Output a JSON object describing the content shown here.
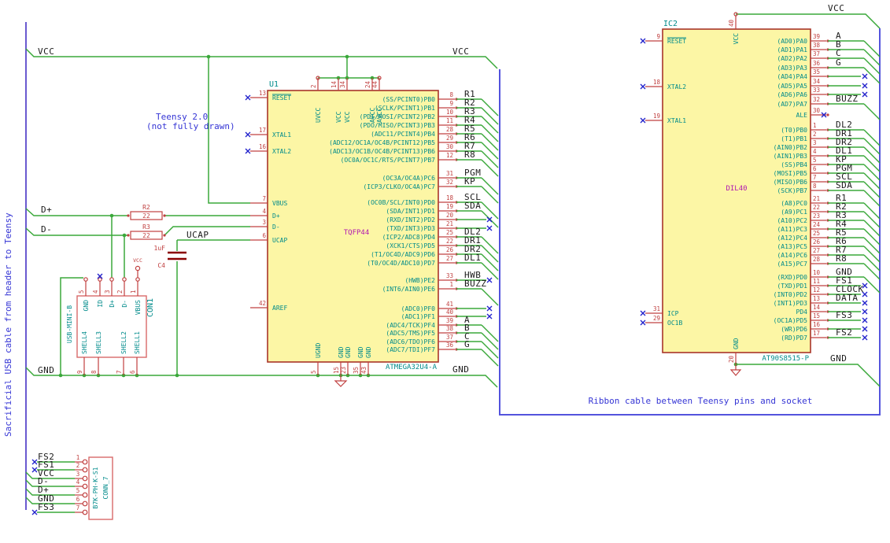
{
  "notes": {
    "left_cable": "Sacrificial USB cable from header to Teensy",
    "teensy_title": "Teensy 2.0",
    "teensy_sub": "(not fully drawn)",
    "ribbon": "Ribbon cable between Teensy pins and socket"
  },
  "power": {
    "vcc": "VCC",
    "gnd": "GND",
    "ucap": "UCAP",
    "dp": "D+",
    "dm": "D-",
    "vcc_small": "VCC"
  },
  "colors": {
    "wire": "#3aa83a",
    "pin": "#c04040",
    "body_border": "#a8352a",
    "body_fill": "#fcf6a5",
    "connector_border": "#d96a6a",
    "nc": "#2323cc",
    "frame": "#5353dd",
    "cable": "#6a5ad0",
    "junction": "#3aa83a",
    "plate": "#8a0000"
  },
  "u1": {
    "ref": "U1",
    "value": "TQFP44",
    "part": "ATMEGA32U4-A",
    "left_pins": [
      {
        "num": "13",
        "name": "RESET",
        "nc": true,
        "overline": true
      },
      {
        "num": "17",
        "name": "XTAL1",
        "nc": true
      },
      {
        "num": "16",
        "name": "XTAL2",
        "nc": true
      },
      {
        "num": "7",
        "name": "VBUS"
      },
      {
        "num": "4",
        "name": "D+"
      },
      {
        "num": "3",
        "name": "D-"
      },
      {
        "num": "6",
        "name": "UCAP"
      },
      {
        "num": "42",
        "name": "AREF"
      }
    ],
    "top_pins": [
      {
        "num": "2",
        "name": "UVCC"
      },
      {
        "num": "14",
        "name": "VCC"
      },
      {
        "num": "34",
        "name": "VCC"
      },
      {
        "num": "24",
        "name": "AVCC"
      },
      {
        "num": "44",
        "name": "AVCC"
      }
    ],
    "bottom_pins": [
      {
        "num": "5",
        "name": "UGND"
      },
      {
        "num": "15",
        "name": "GND"
      },
      {
        "num": "23",
        "name": "GND"
      },
      {
        "num": "35",
        "name": "GND"
      },
      {
        "num": "43",
        "name": "GND"
      }
    ],
    "right_groups": [
      {
        "pins": [
          {
            "num": "8",
            "name": "(SS/PCINT0)PB0",
            "net": "R1"
          },
          {
            "num": "9",
            "name": "(SCLK/PCINT1)PB1",
            "net": "R2"
          },
          {
            "num": "10",
            "name": "(PDI/MOSI/PCINT2)PB2",
            "net": "R3"
          },
          {
            "num": "11",
            "name": "(PDO/MISO/PCINT3)PB3",
            "net": "R4"
          },
          {
            "num": "28",
            "name": "(ADC11/PCINT4)PB4",
            "net": "R5"
          },
          {
            "num": "29",
            "name": "(ADC12/OC1A/OC4B/PCINT12)PB5",
            "net": "R6"
          },
          {
            "num": "30",
            "name": "(ADC13/OC1B/OC4B/PCINT13)PB6",
            "net": "R7"
          },
          {
            "num": "12",
            "name": "(OC0A/OC1C/RTS/PCINT7)PB7",
            "net": "R8"
          }
        ]
      },
      {
        "pins": [
          {
            "num": "31",
            "name": "(OC3A/OC4A)PC6",
            "net": "PGM"
          },
          {
            "num": "32",
            "name": "(ICP3/CLKO/OC4A)PC7",
            "net": "KP"
          }
        ]
      },
      {
        "pins": [
          {
            "num": "18",
            "name": "(OC0B/SCL/INT0)PD0",
            "net": "SCL"
          },
          {
            "num": "19",
            "name": "(SDA/INT1)PD1",
            "net": "SDA"
          },
          {
            "num": "20",
            "name": "(RXD/INT2)PD2",
            "nc": true
          },
          {
            "num": "21",
            "name": "(TXD/INT3)PD3",
            "nc": true
          },
          {
            "num": "25",
            "name": "(ICP2/ADC8)PD4",
            "net": "DL2"
          },
          {
            "num": "22",
            "name": "(XCK1/CTS)PD5",
            "net": "DR1"
          },
          {
            "num": "26",
            "name": "(T1/OC4D/ADC9)PD6",
            "net": "DR2"
          },
          {
            "num": "27",
            "name": "(T0/OC4D/ADC10)PD7",
            "net": "DL1"
          }
        ]
      },
      {
        "pins": [
          {
            "num": "33",
            "name": "(HWB)PE2",
            "net": "HWB",
            "nc": true
          },
          {
            "num": "1",
            "name": "(INT6/AIN0)PE6",
            "net": "BUZZ"
          }
        ]
      },
      {
        "pins": [
          {
            "num": "41",
            "name": "(ADC0)PF0",
            "nc": true
          },
          {
            "num": "40",
            "name": "(ADC1)PF1",
            "nc": true
          },
          {
            "num": "39",
            "name": "(ADC4/TCK)PF4",
            "net": "A"
          },
          {
            "num": "38",
            "name": "(ADC5/TMS)PF5",
            "net": "B"
          },
          {
            "num": "37",
            "name": "(ADC6/TDO)PF6",
            "net": "C"
          },
          {
            "num": "36",
            "name": "(ADC7/TDI)PF7",
            "net": "G"
          }
        ]
      }
    ]
  },
  "ic2": {
    "ref": "IC2",
    "value": "DIL40",
    "part": "AT90S8515-P",
    "left_pins": [
      {
        "num": "9",
        "name": "RESET",
        "nc": true,
        "overline": true
      },
      {
        "num": "18",
        "name": "XTAL2",
        "nc": true
      },
      {
        "num": "19",
        "name": "XTAL1",
        "nc": true
      },
      {
        "num": "31",
        "name": "ICP",
        "nc": true
      },
      {
        "num": "29",
        "name": "OC1B",
        "nc": true
      }
    ],
    "top_pins": [
      {
        "num": "40",
        "name": "VCC"
      }
    ],
    "bottom_pins": [
      {
        "num": "20",
        "name": "GND"
      }
    ],
    "right_groups": [
      {
        "pins": [
          {
            "num": "39",
            "name": "(AD0)PA0",
            "net": "A"
          },
          {
            "num": "38",
            "name": "(AD1)PA1",
            "net": "B"
          },
          {
            "num": "37",
            "name": "(AD2)PA2",
            "net": "C"
          },
          {
            "num": "36",
            "name": "(AD3)PA3",
            "net": "G"
          },
          {
            "num": "35",
            "name": "(AD4)PA4",
            "nc": true
          },
          {
            "num": "34",
            "name": "(AD5)PA5",
            "nc": true
          },
          {
            "num": "33",
            "name": "(AD6)PA6",
            "nc": true
          },
          {
            "num": "32",
            "name": "(AD7)PA7",
            "net": "BUZZ"
          }
        ]
      },
      {
        "pins": [
          {
            "num": "30",
            "name": "ALE",
            "nc": true,
            "short": true
          }
        ]
      },
      {
        "pins": [
          {
            "num": "1",
            "name": "(T0)PB0",
            "net": "DL2"
          },
          {
            "num": "2",
            "name": "(T1)PB1",
            "net": "DR1"
          },
          {
            "num": "3",
            "name": "(AIN0)PB2",
            "net": "DR2"
          },
          {
            "num": "4",
            "name": "(AIN1)PB3",
            "net": "DL1"
          },
          {
            "num": "5",
            "name": "(SS)PB4",
            "net": "KP"
          },
          {
            "num": "6",
            "name": "(MOSI)PB5",
            "net": "PGM"
          },
          {
            "num": "7",
            "name": "(MISO)PB6",
            "net": "SCL"
          },
          {
            "num": "8",
            "name": "(SCK)PB7",
            "net": "SDA"
          }
        ]
      },
      {
        "pins": [
          {
            "num": "21",
            "name": "(A8)PC0",
            "net": "R1"
          },
          {
            "num": "22",
            "name": "(A9)PC1",
            "net": "R2"
          },
          {
            "num": "23",
            "name": "(A10)PC2",
            "net": "R3"
          },
          {
            "num": "24",
            "name": "(A11)PC3",
            "net": "R4"
          },
          {
            "num": "25",
            "name": "(A12)PC4",
            "net": "R5"
          },
          {
            "num": "26",
            "name": "(A13)PC5",
            "net": "R6"
          },
          {
            "num": "27",
            "name": "(A14)PC6",
            "net": "R7"
          },
          {
            "num": "28",
            "name": "(A15)PC7",
            "net": "R8"
          }
        ]
      },
      {
        "pins": [
          {
            "num": "10",
            "name": "(RXD)PD0",
            "net": "GND"
          },
          {
            "num": "11",
            "name": "(TXD)PD1",
            "net": "FS1",
            "nc": true
          },
          {
            "num": "12",
            "name": "(INT0)PD2",
            "net": "CLOCK",
            "nc": true
          },
          {
            "num": "13",
            "name": "(INT1)PD3",
            "net": "DATA",
            "nc": true
          },
          {
            "num": "14",
            "name": "PD4",
            "nc": true
          },
          {
            "num": "15",
            "name": "(OC1A)PD5",
            "net": "FS3",
            "nc": true
          },
          {
            "num": "16",
            "name": "(WR)PD6",
            "nc": true
          },
          {
            "num": "17",
            "name": "(RD)PD7",
            "net": "FS2",
            "nc": true
          }
        ]
      }
    ]
  },
  "usb": {
    "ref": "CON1",
    "value": "USB-MINI-B",
    "top_pins": [
      {
        "num": "5",
        "name": "GND"
      },
      {
        "num": "4",
        "name": "ID",
        "nc": true
      },
      {
        "num": "3",
        "name": "D+"
      },
      {
        "num": "2",
        "name": "D-"
      },
      {
        "num": "1",
        "name": "VBUS"
      }
    ],
    "shell_pins": [
      {
        "num": "9",
        "name": "SHELL4"
      },
      {
        "num": "8",
        "name": "SHELL3"
      },
      {
        "num": "7",
        "name": "SHELL2"
      },
      {
        "num": "6",
        "name": "SHELL1"
      }
    ]
  },
  "conn7": {
    "ref": "CONN_7",
    "value": "B7K-PH-K-S1",
    "rows": [
      {
        "num": "1",
        "net": "FS2",
        "nc": true
      },
      {
        "num": "2",
        "net": "FS1",
        "nc": true
      },
      {
        "num": "3",
        "net": "VCC"
      },
      {
        "num": "4",
        "net": "D-"
      },
      {
        "num": "5",
        "net": "D+"
      },
      {
        "num": "6",
        "net": "GND"
      },
      {
        "num": "7",
        "net": "FS3",
        "nc": true
      }
    ]
  },
  "resistors": [
    {
      "ref": "R2",
      "value": "22"
    },
    {
      "ref": "R3",
      "value": "22"
    }
  ],
  "capacitor": {
    "ref": "C4",
    "value": "1uF"
  }
}
